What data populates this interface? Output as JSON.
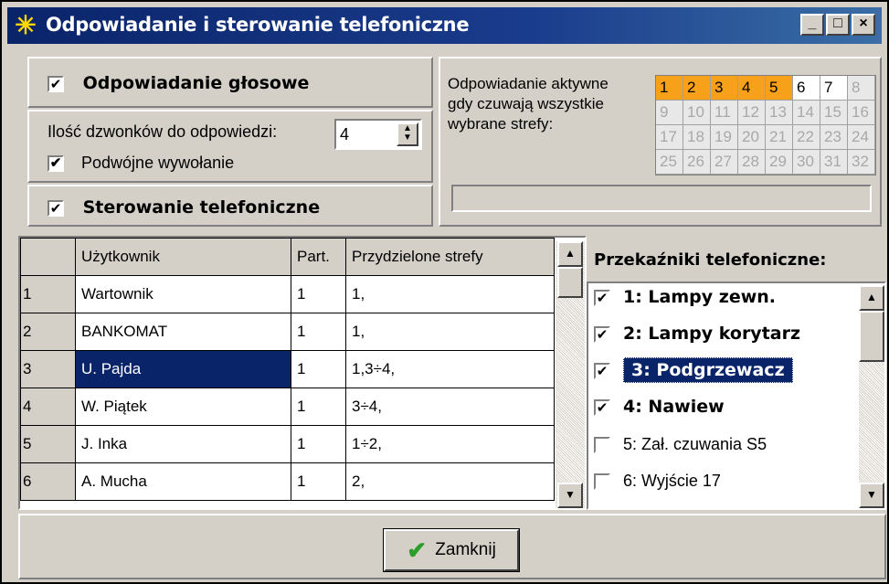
{
  "window": {
    "title": "Odpowiadanie i sterowanie telefoniczne",
    "buttons": {
      "minimize": "_",
      "maximize": "□",
      "close": "×"
    }
  },
  "voice": {
    "label": "Odpowiadanie głosowe",
    "checked": "✔"
  },
  "rings": {
    "label": "Ilość dzwonków do odpowiedzi:",
    "value": "4",
    "double_label": "Podwójne wywołanie"
  },
  "control": {
    "label": "Sterowanie telefoniczne"
  },
  "zones": {
    "label_line1": "Odpowiadanie aktywne",
    "label_line2": "gdy czuwają wszystkie",
    "label_line3": "wybrane strefy:",
    "selected": [
      1,
      2,
      3,
      4,
      5
    ],
    "active": [
      6,
      7
    ]
  },
  "users_table": {
    "headers": [
      "",
      "Użytkownik",
      "Part.",
      "Przydzielone strefy"
    ],
    "rows": [
      {
        "n": "1",
        "name": "Wartownik",
        "part": "1",
        "zones": "1,"
      },
      {
        "n": "2",
        "name": "BANKOMAT",
        "part": "1",
        "zones": "1,"
      },
      {
        "n": "3",
        "name": "U. Pajda",
        "part": "1",
        "zones": "1,3÷4,"
      },
      {
        "n": "4",
        "name": "W. Piątek",
        "part": "1",
        "zones": "3÷4,"
      },
      {
        "n": "5",
        "name": "J. Inka",
        "part": "1",
        "zones": "1÷2,"
      },
      {
        "n": "6",
        "name": "A. Mucha",
        "part": "1",
        "zones": "2,"
      }
    ]
  },
  "relays": {
    "title": "Przekaźniki telefoniczne:",
    "items": [
      {
        "label": "1: Lampy zewn.",
        "checked": "✔"
      },
      {
        "label": "2: Lampy korytarz",
        "checked": "✔"
      },
      {
        "label": "3: Podgrzewacz",
        "checked": "✔"
      },
      {
        "label": "4: Nawiew",
        "checked": "✔"
      },
      {
        "label": "5: Zał. czuwania S5",
        "checked": ""
      },
      {
        "label": "6: Wyjście 17",
        "checked": ""
      }
    ]
  },
  "footer": {
    "close_label": "Zamknij"
  },
  "colors": {
    "title_bar": "#0a246a",
    "selection": "#0a246a",
    "zone_selected": "#f7a11a",
    "window_bg": "#d4d0c8"
  }
}
